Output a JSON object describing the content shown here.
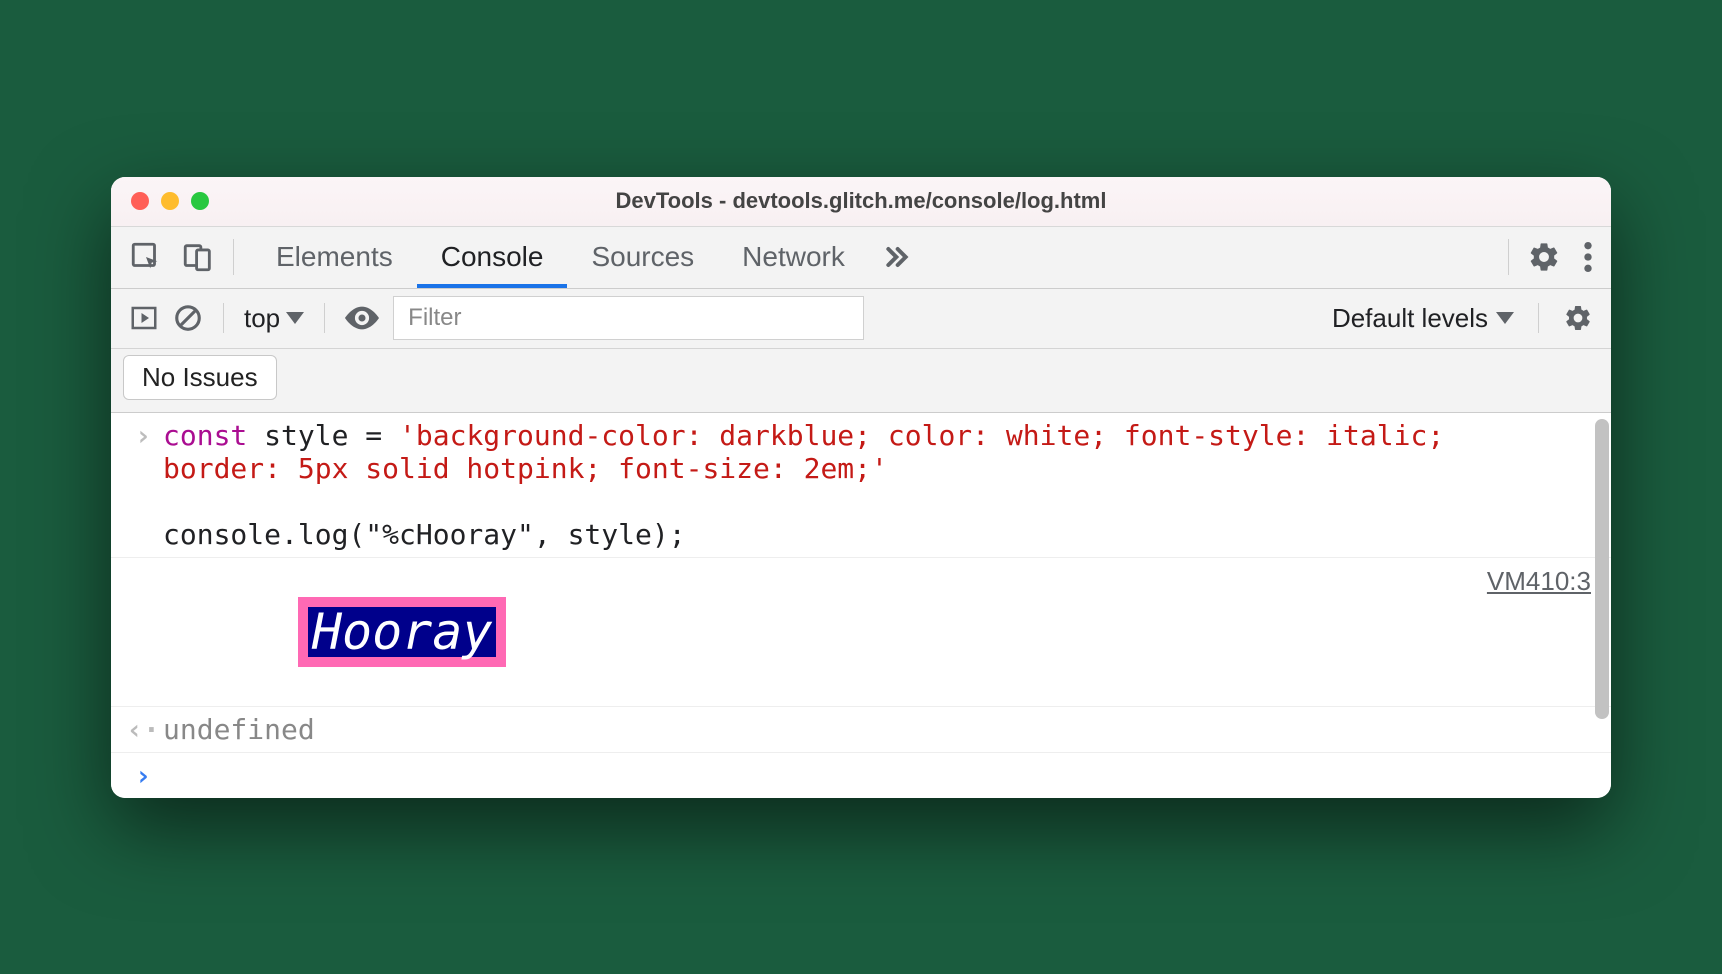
{
  "window": {
    "title": "DevTools - devtools.glitch.me/console/log.html"
  },
  "tabs": {
    "elements": "Elements",
    "console": "Console",
    "sources": "Sources",
    "network": "Network"
  },
  "toolbar": {
    "context": "top",
    "filter_placeholder": "Filter",
    "levels": "Default levels"
  },
  "issues": {
    "label": "No Issues"
  },
  "console": {
    "code_keyword": "const",
    "code_mid": " style = ",
    "code_string": "'background-color: darkblue; color: white; font-style: italic; border: 5px solid hotpink; font-size: 2em;'",
    "code_line2": "console.log(\"%cHooray\", style);",
    "styled_text": "Hooray",
    "source_ref": "VM410:3",
    "return_value": "undefined"
  }
}
